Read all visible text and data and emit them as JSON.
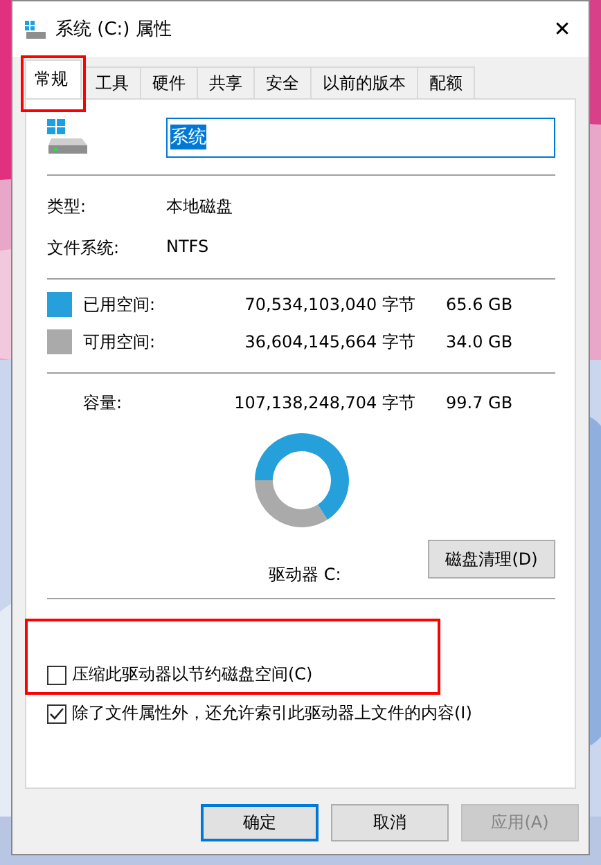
{
  "window": {
    "title": "系统 (C:) 属性",
    "close": "✕"
  },
  "tabs": [
    {
      "label": "常规",
      "selected": true,
      "highlighted": true
    },
    {
      "label": "工具",
      "selected": false,
      "highlighted": false
    },
    {
      "label": "硬件",
      "selected": false,
      "highlighted": false
    },
    {
      "label": "共享",
      "selected": false,
      "highlighted": false
    },
    {
      "label": "安全",
      "selected": false,
      "highlighted": false
    },
    {
      "label": "以前的版本",
      "selected": false,
      "highlighted": false
    },
    {
      "label": "配额",
      "selected": false,
      "highlighted": false
    }
  ],
  "name_field": {
    "value": "系统",
    "text_selected": true
  },
  "info": [
    {
      "label": "类型:",
      "value": "本地磁盘"
    },
    {
      "label": "文件系统:",
      "value": "NTFS"
    }
  ],
  "space": [
    {
      "label": "已用空间:",
      "bytes": "70,534,103,040 字节",
      "size": "65.6 GB",
      "color": "#26a0da"
    },
    {
      "label": "可用空间:",
      "bytes": "36,604,145,664 字节",
      "size": "34.0 GB",
      "color": "#aaaaaa"
    }
  ],
  "capacity": {
    "label": "容量:",
    "bytes": "107,138,248,704 字节",
    "size": "99.7 GB"
  },
  "usage_chart": {
    "chart_data": {
      "type": "donut",
      "values": [
        65.6,
        34.0
      ]
    }
  },
  "drive_label": "驱动器 C:",
  "cleanup_button": "磁盘清理(D)",
  "options": [
    {
      "label": "压缩此驱动器以节约磁盘空间(C)",
      "checked": false,
      "highlighted": true
    },
    {
      "label": "除了文件属性外，还允许索引此驱动器上文件的内容(I)",
      "checked": true,
      "highlighted": false
    }
  ],
  "buttons": [
    {
      "label": "确定",
      "kind": "default",
      "disabled": false
    },
    {
      "label": "取消",
      "kind": "normal",
      "disabled": false
    },
    {
      "label": "应用(A)",
      "kind": "normal",
      "disabled": true
    }
  ]
}
